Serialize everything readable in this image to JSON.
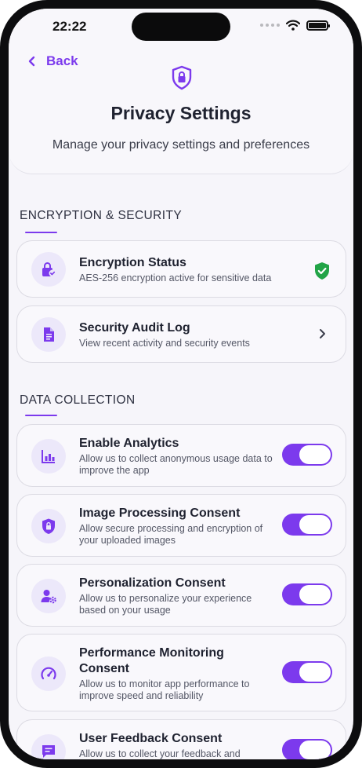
{
  "status_bar": {
    "time": "22:22"
  },
  "header": {
    "back_label": "Back",
    "title": "Privacy Settings",
    "subtitle": "Manage your privacy settings and preferences"
  },
  "sections": {
    "encryption": {
      "title": "ENCRYPTION & SECURITY",
      "items": [
        {
          "title": "Encryption Status",
          "description": "AES-256 encryption active for sensitive data",
          "icon": "lock-check-icon",
          "status_icon": "shield-check-icon"
        },
        {
          "title": "Security Audit Log",
          "description": "View recent activity and security events",
          "icon": "document-icon",
          "status_icon": "chevron-right-icon"
        }
      ]
    },
    "data_collection": {
      "title": "DATA COLLECTION",
      "items": [
        {
          "title": "Enable Analytics",
          "description": "Allow us to collect anonymous usage data to improve the app",
          "icon": "bar-chart-icon",
          "enabled": true
        },
        {
          "title": "Image Processing Consent",
          "description": "Allow secure processing and encryption of your uploaded images",
          "icon": "shield-lock-icon",
          "enabled": true
        },
        {
          "title": "Personalization Consent",
          "description": "Allow us to personalize your experience based on your usage",
          "icon": "user-settings-icon",
          "enabled": true
        },
        {
          "title": "Performance Monitoring Consent",
          "description": "Allow us to monitor app performance to improve speed and reliability",
          "icon": "speedometer-icon",
          "enabled": true
        },
        {
          "title": "User Feedback Consent",
          "description": "Allow us to collect your feedback and",
          "icon": "feedback-icon",
          "enabled": true
        }
      ]
    }
  },
  "colors": {
    "accent": "#7c3aed",
    "accent_soft": "#ece8fa",
    "success": "#22a447",
    "background": "#f6f5fa"
  }
}
